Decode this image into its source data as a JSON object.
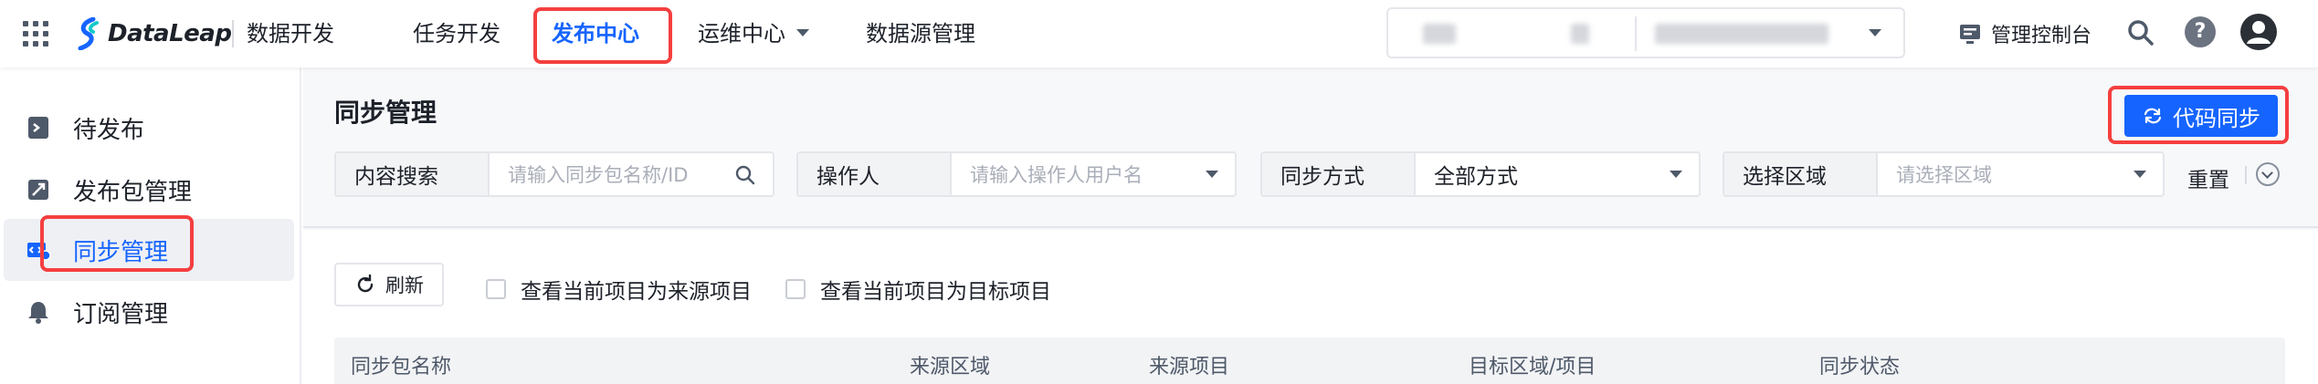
{
  "app": {
    "logo_text": "DataLeap",
    "product_name": "数据开发"
  },
  "topnav": {
    "items": [
      {
        "label": "任务开发"
      },
      {
        "label": "发布中心"
      },
      {
        "label": "运维中心"
      },
      {
        "label": "数据源管理"
      }
    ],
    "active_index": 1,
    "console_label": "管理控制台"
  },
  "sidebar": {
    "items": [
      {
        "label": "待发布"
      },
      {
        "label": "发布包管理"
      },
      {
        "label": "同步管理"
      },
      {
        "label": "订阅管理"
      }
    ],
    "active_index": 2
  },
  "page": {
    "title": "同步管理",
    "sync_button": "代码同步"
  },
  "filters": {
    "content_search": {
      "label": "内容搜索",
      "placeholder": "请输入同步包名称/ID"
    },
    "operator": {
      "label": "操作人",
      "placeholder": "请输入操作人用户名"
    },
    "sync_method": {
      "label": "同步方式",
      "value": "全部方式"
    },
    "region": {
      "label": "选择区域",
      "placeholder": "请选择区域"
    },
    "reset_label": "重置"
  },
  "toolbar": {
    "refresh_label": "刷新",
    "checkbox_source": "查看当前项目为来源项目",
    "checkbox_target": "查看当前项目为目标项目"
  },
  "table": {
    "columns": [
      "同步包名称",
      "来源区域",
      "来源项目",
      "目标区域/项目",
      "同步状态"
    ]
  },
  "colors": {
    "accent": "#1664ff",
    "highlight": "#f53f3f"
  }
}
